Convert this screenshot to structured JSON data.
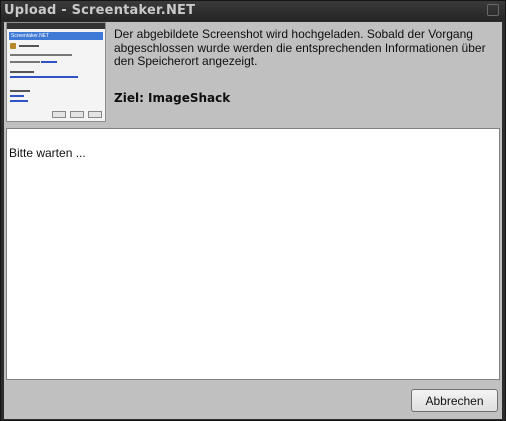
{
  "window": {
    "title": "Upload - Screentaker.NET"
  },
  "header": {
    "description": "Der abgebildete Screenshot wird hochgeladen. Sobald der Vorgang abgeschlossen wurde werden die entsprechenden Informationen über den Speicherort angezeigt.",
    "target": "Ziel: ImageShack",
    "thumbnail_icon": "screenshot-thumbnail"
  },
  "output": {
    "status_text": "Bitte warten ..."
  },
  "footer": {
    "cancel_label": "Abbrechen"
  },
  "colors": {
    "titlebar": "#2c2c2c",
    "title_text": "#c9c9c9",
    "client_bg": "#c0c0c0",
    "output_bg": "#ffffff"
  }
}
